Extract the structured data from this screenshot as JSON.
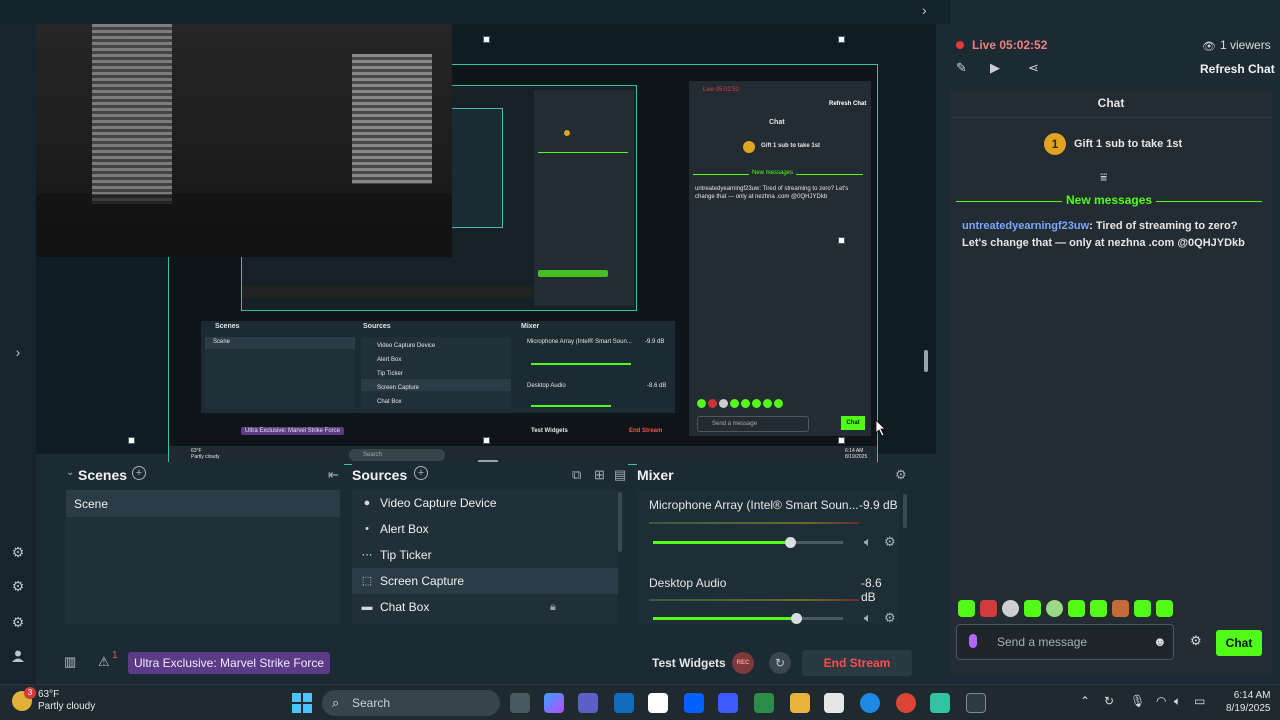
{
  "window": {
    "minimize": "—",
    "maximize": "☐",
    "close": "✕"
  },
  "chat_header": {
    "live_label": "Live 05:02:52",
    "viewers": "1 viewers",
    "refresh": "Refresh Chat"
  },
  "chat": {
    "title": "Chat",
    "gift": "Gift 1 sub to take 1st",
    "gift_badge": "1",
    "new_messages": "New messages",
    "message_user": "untreatedyearningf23uw",
    "message_text": ": Tired of streaming to zero? Let's change that — only at nezhna .com @0QHJYDkb",
    "input_placeholder": "Send a message",
    "send_button": "Chat"
  },
  "scenes": {
    "title": "Scenes",
    "items": [
      "Scene"
    ]
  },
  "sources": {
    "title": "Sources",
    "items": [
      {
        "label": "Video Capture Device",
        "icon": "camera-icon"
      },
      {
        "label": "Alert Box",
        "icon": "alert-icon"
      },
      {
        "label": "Tip Ticker",
        "icon": "ticker-icon"
      },
      {
        "label": "Screen Capture",
        "icon": "screen-icon"
      },
      {
        "label": "Chat Box",
        "icon": "chat-icon"
      }
    ]
  },
  "mixer": {
    "title": "Mixer",
    "channels": [
      {
        "name": "Microphone Array (Intel® Smart Soun...",
        "level": "-9.9 dB",
        "volume": 0.72
      },
      {
        "name": "Desktop Audio",
        "level": "-8.6 dB",
        "volume": 0.75
      }
    ]
  },
  "bottom_bar": {
    "notif_count": "1",
    "game": "Ultra Exclusive: Marvel Strike Force",
    "test_widgets": "Test Widgets",
    "rec": "REC",
    "end_stream": "End Stream"
  },
  "taskbar": {
    "weather_temp": "63°F",
    "weather_desc": "Partly cloudy",
    "weather_badge": "3",
    "search": "Search",
    "time": "6:14 AM",
    "date": "8/19/2025"
  },
  "preview_mini": {
    "live": "Live 05:02:52",
    "refresh": "Refresh Chat",
    "chat_title": "Chat",
    "gift": "Gift 1 sub to take 1st",
    "new_messages": "New messages",
    "msg": "untreatedyearningf23uw: Tired of streaming to zero? Let's change that — only at nezhna .com @0QHJYDkb",
    "send": "Send a message",
    "chat_btn": "Chat",
    "scenes": "Scenes",
    "scene": "Scene",
    "sources": "Sources",
    "src": [
      "Video Capture Device",
      "Alert Box",
      "Tip Ticker",
      "Screen Capture",
      "Chat Box"
    ],
    "mixer": "Mixer",
    "mic": "Microphone Array (Intel® Smart Soun...",
    "mic_db": "-9.9 dB",
    "desk": "Desktop Audio",
    "desk_db": "-8.6 dB",
    "game": "Ultra Exclusive: Marvel Strike Force",
    "test_widgets": "Test Widgets",
    "end_stream": "End Stream",
    "temp": "63°F",
    "weather": "Partly cloudy",
    "search": "Search",
    "time": "6:14 AM",
    "date": "8/19/2025"
  },
  "colors": {
    "accent": "#53fc18",
    "selection": "#31c3a2",
    "live_dot": "#e53935",
    "username": "#7aa7ff",
    "end_stream": "#ff4d4d",
    "game_pill": "#5b3a86"
  }
}
